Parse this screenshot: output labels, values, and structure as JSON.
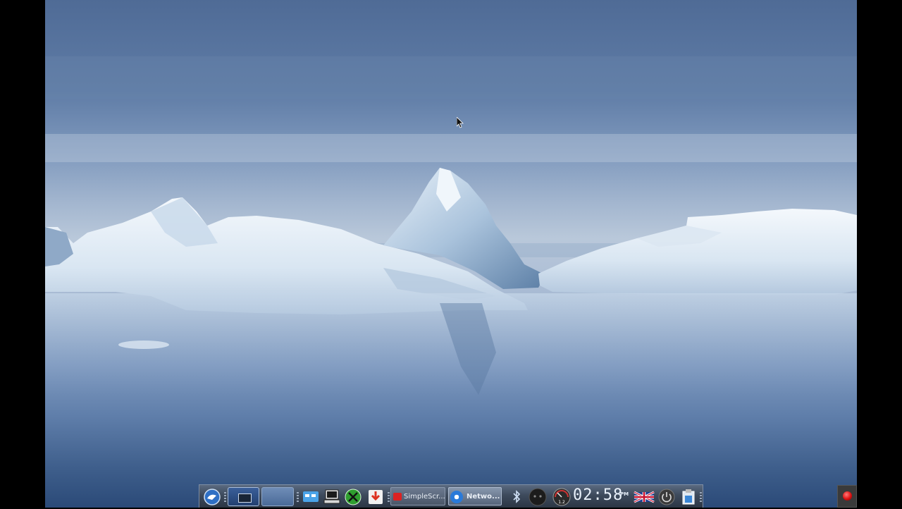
{
  "desktop": {
    "wallpaper": "arctic-icebergs",
    "colors": {
      "sky_top": "#4f6b96",
      "horizon": "#b9c8da",
      "water_bottom": "#2b4a78",
      "ice": "#e8f0f8"
    }
  },
  "taskbar": {
    "launcher_icon": "app-launcher-icon",
    "workspaces": [
      {
        "name": "workspace-1",
        "active": true
      },
      {
        "name": "workspace-2",
        "active": false
      }
    ],
    "quick_launch": [
      {
        "icon": "file-manager-icon"
      },
      {
        "icon": "terminal-icon"
      },
      {
        "icon": "xbox-icon"
      },
      {
        "icon": "download-icon"
      }
    ],
    "tasks": [
      {
        "label": "SimpleScr...",
        "icon": "record-app-icon"
      },
      {
        "label": "Netwo...",
        "icon": "network-gear-icon"
      }
    ],
    "tray": {
      "bluetooth_icon": "bluetooth-icon",
      "monitor_icon": "system-monitor-icon",
      "cpu_gauge_label": "1.2",
      "clock_time": "02:58",
      "clock_ampm": "PM",
      "keyboard_layout_icon": "uk-flag-icon",
      "power_icon": "power-icon",
      "storage_icon": "clipboard-icon"
    }
  },
  "recording_indicator": {
    "icon": "record-dot-icon",
    "color": "#dd1111"
  }
}
